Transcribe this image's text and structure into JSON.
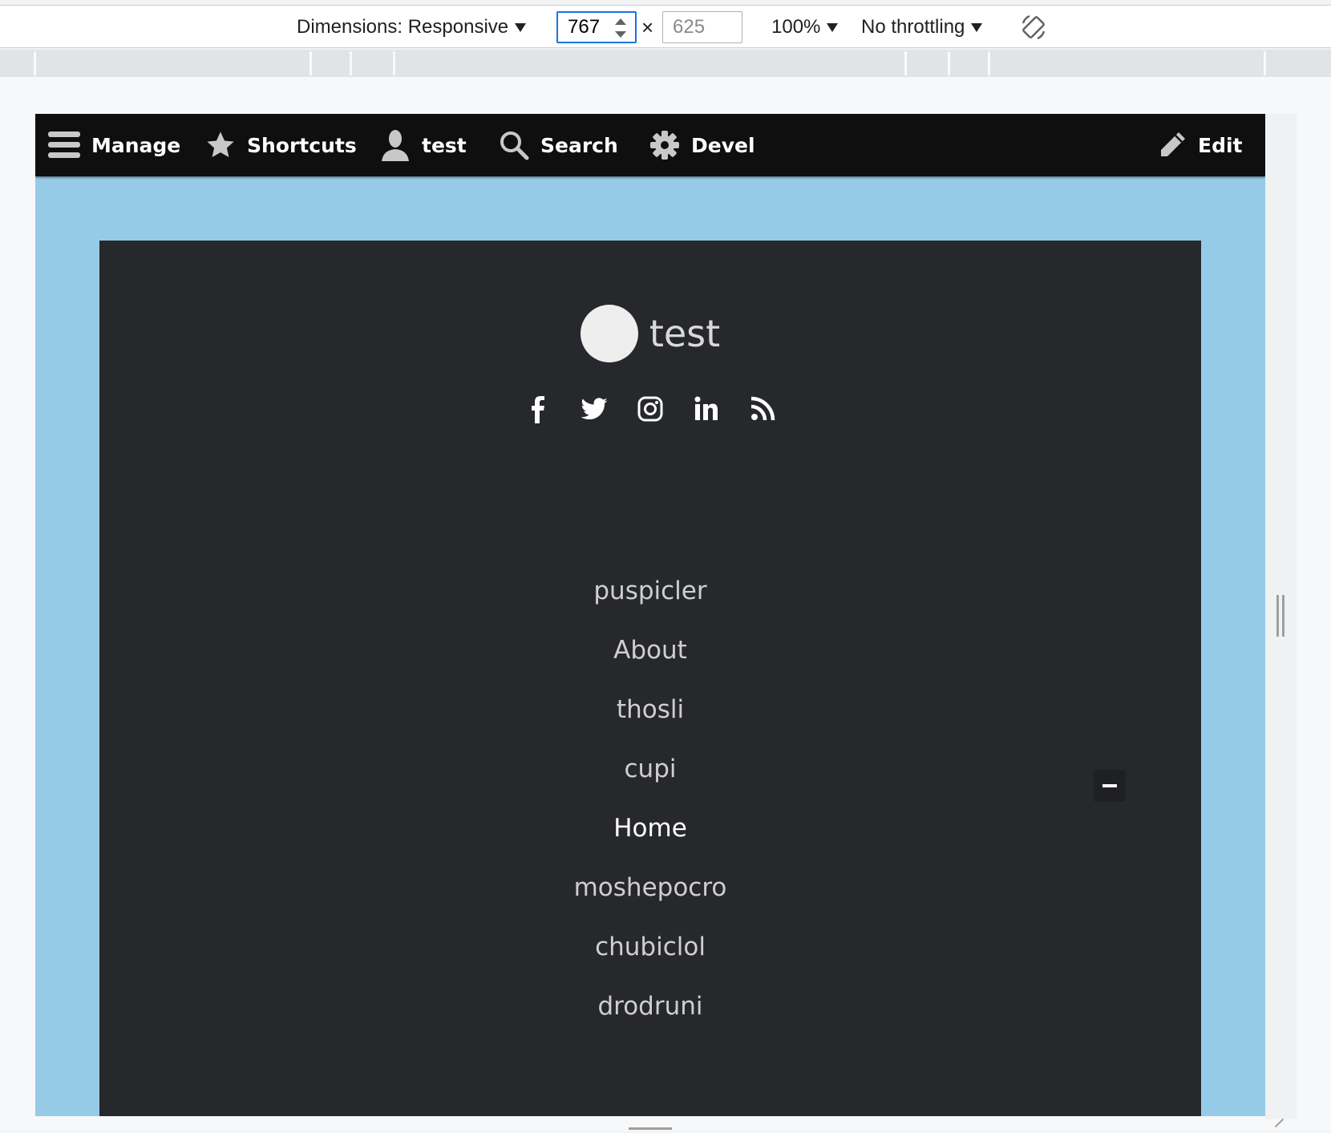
{
  "devtools": {
    "dimensions_label": "Dimensions: Responsive",
    "width_value": "767",
    "height_placeholder": "625",
    "times_sign": "×",
    "zoom": "100%",
    "throttling": "No throttling",
    "accent_color": "#1a73e8"
  },
  "admin_toolbar": {
    "items": [
      {
        "label": "Manage",
        "icon": "hamburger-icon"
      },
      {
        "label": "Shortcuts",
        "icon": "star-icon"
      },
      {
        "label": "test",
        "icon": "user-icon"
      },
      {
        "label": "Search",
        "icon": "search-icon"
      },
      {
        "label": "Devel",
        "icon": "gear-icon"
      }
    ],
    "edit": {
      "label": "Edit",
      "icon": "pencil-icon"
    }
  },
  "site": {
    "name": "test",
    "social_icons": [
      "facebook-icon",
      "twitter-icon",
      "instagram-icon",
      "linkedin-icon",
      "rss-icon"
    ],
    "menu": [
      "puspicler",
      "About",
      "thosli",
      "cupi",
      "Home",
      "moshepocro",
      "chubiclol",
      "drodruni"
    ],
    "active_menu_item": "Home",
    "background_color": "#96cbe8",
    "panel_color": "#27282c"
  }
}
